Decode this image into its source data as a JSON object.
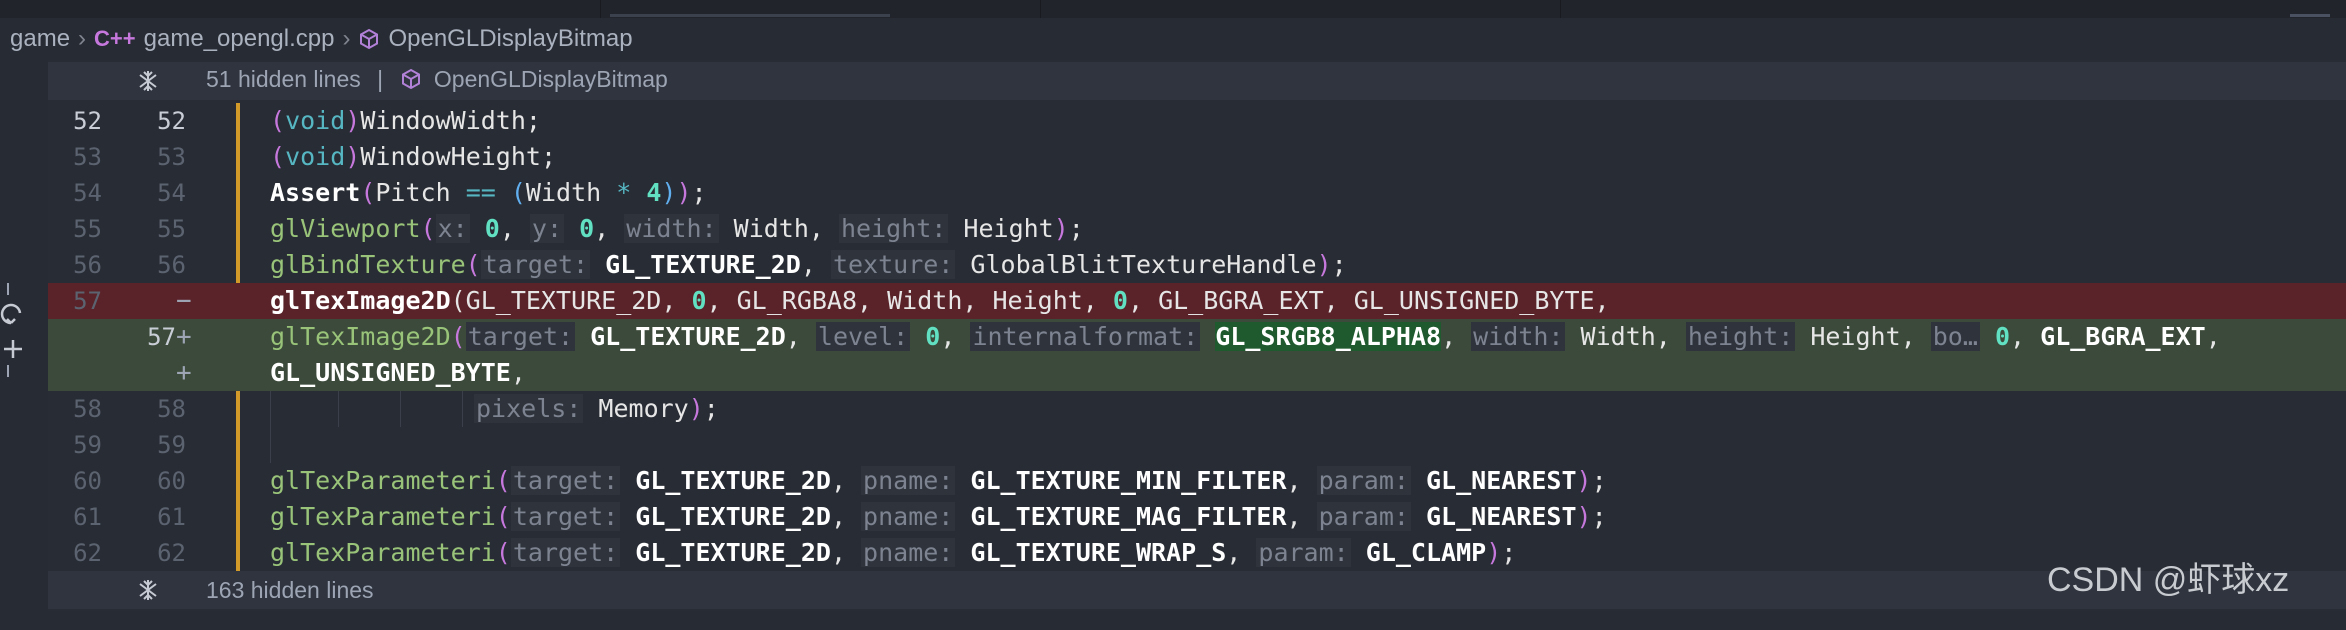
{
  "breadcrumb": {
    "folder": "game",
    "file_icon": "C++",
    "file": "game_opengl.cpp",
    "symbol": "OpenGLDisplayBitmap"
  },
  "hidden_top": {
    "count_label": "51 hidden lines",
    "divider": "|",
    "symbol": "OpenGLDisplayBitmap"
  },
  "hidden_bottom": {
    "count_label": "163 hidden lines"
  },
  "line_numbers": {
    "l52": "52",
    "l53": "53",
    "l54": "54",
    "l55": "55",
    "l56": "56",
    "l57": "57",
    "l57b": "57",
    "l58": "58",
    "l59": "59",
    "l60": "60",
    "l61": "61",
    "l62": "62"
  },
  "diff_markers": {
    "minus": "−",
    "plus": "+"
  },
  "watermark": "CSDN @虾球xz",
  "colors": {
    "accent": "#d19a29",
    "deleted_bg": "#5a2329",
    "added_bg": "#3b4a3a"
  }
}
